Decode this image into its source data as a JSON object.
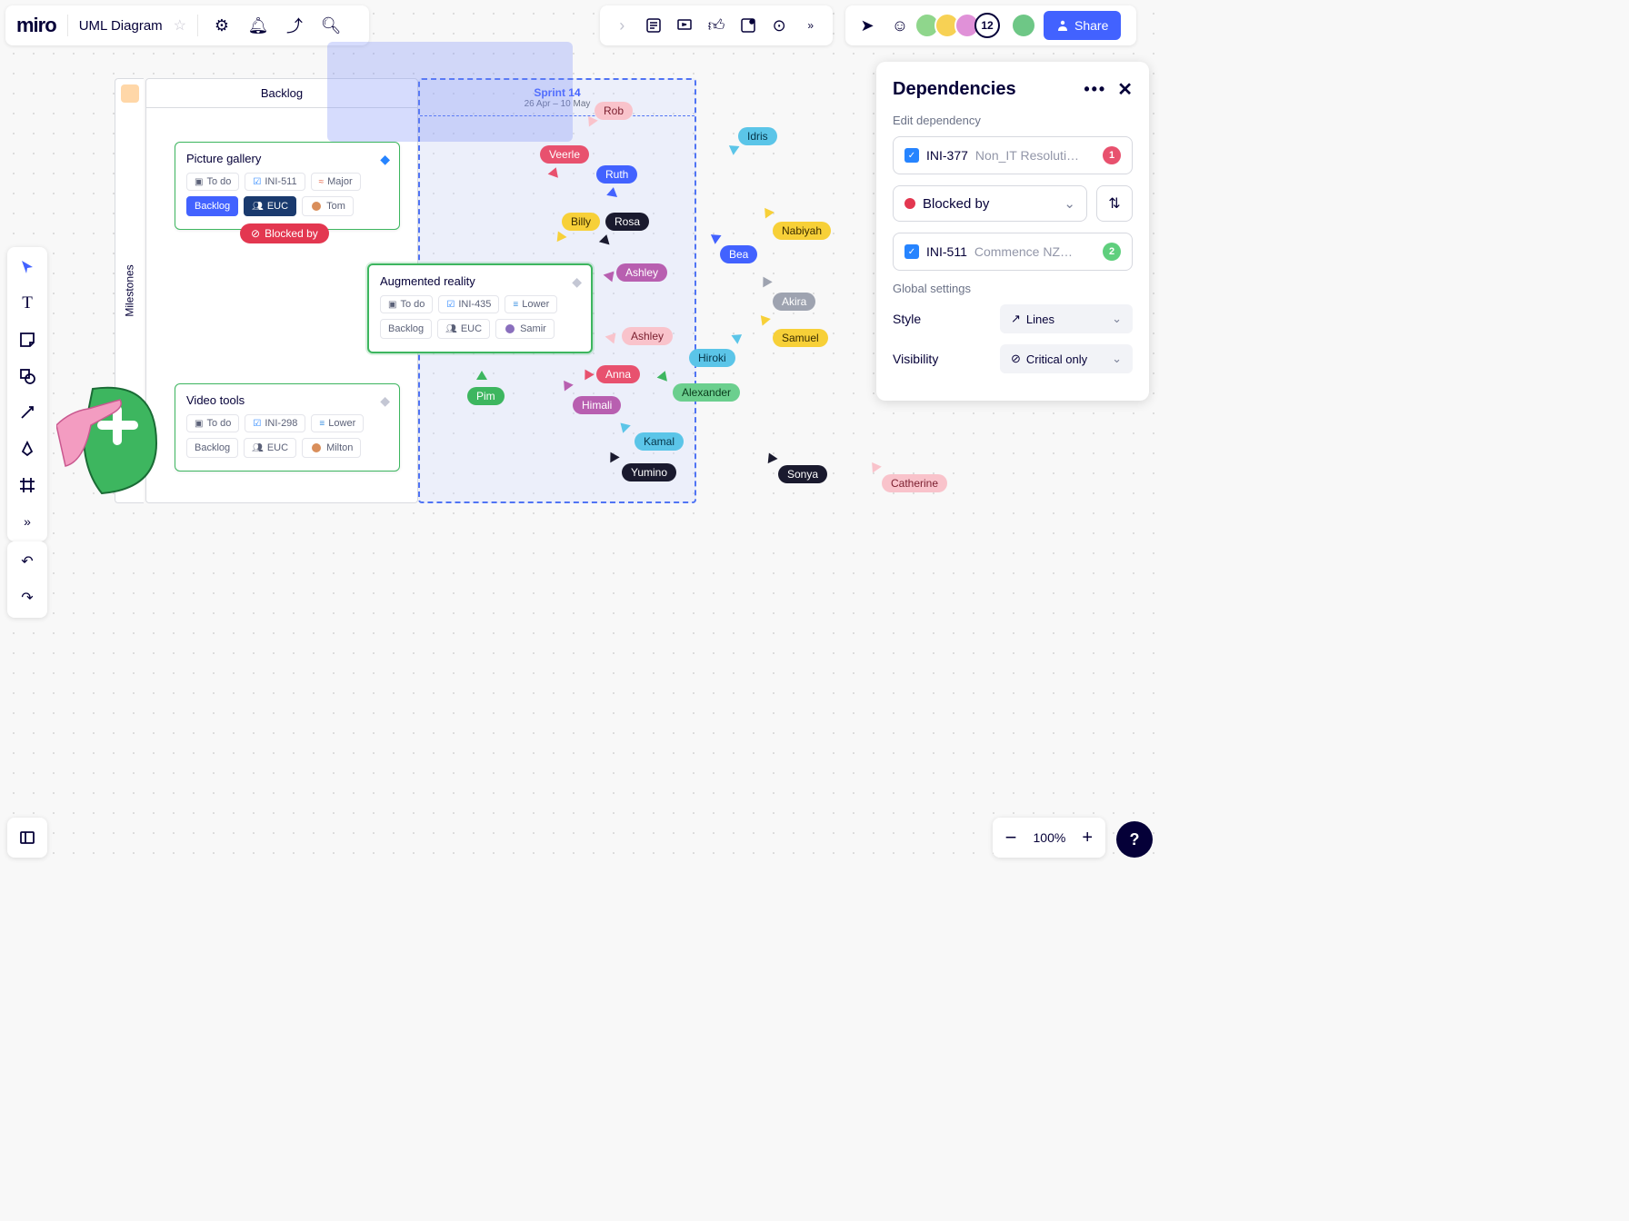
{
  "app": {
    "logo": "miro",
    "board_title": "UML Diagram"
  },
  "share": {
    "label": "Share"
  },
  "collab": {
    "overflow_count": "12"
  },
  "zoom": {
    "level": "100%"
  },
  "columns": {
    "backlog": "Backlog",
    "sprint_title": "Sprint 14",
    "sprint_dates": "26 Apr – 10 May",
    "milestones": "Milestones"
  },
  "cards": {
    "picture": {
      "title": "Picture gallery",
      "todo": "To do",
      "id": "INI-511",
      "priority": "Major",
      "status": "Backlog",
      "team": "EUC",
      "assignee": "Tom"
    },
    "augmented": {
      "title": "Augmented reality",
      "todo": "To do",
      "id": "INI-435",
      "priority": "Lower",
      "status": "Backlog",
      "team": "EUC",
      "assignee": "Samir"
    },
    "video": {
      "title": "Video tools",
      "todo": "To do",
      "id": "INI-298",
      "priority": "Lower",
      "status": "Backlog",
      "team": "EUC",
      "assignee": "Milton"
    }
  },
  "blocked_badge": "Blocked by",
  "cursors": {
    "rob": "Rob",
    "veerle": "Veerle",
    "ruth": "Ruth",
    "billy": "Billy",
    "rosa": "Rosa",
    "ashley1": "Ashley",
    "ashley2": "Ashley",
    "pim": "Pim",
    "anna": "Anna",
    "alexander": "Alexander",
    "himali": "Himali",
    "kamal": "Kamal",
    "yumino": "Yumino",
    "idris": "Idris",
    "bea": "Bea",
    "nabiyah": "Nabiyah",
    "akira": "Akira",
    "samuel": "Samuel",
    "hiroki": "Hiroki",
    "sonya": "Sonya",
    "catherine": "Catherine"
  },
  "dependencies": {
    "title": "Dependencies",
    "edit_label": "Edit dependency",
    "item1_id": "INI-377",
    "item1_name": "Non_IT Resoluti…",
    "item1_badge": "1",
    "relation": "Blocked by",
    "item2_id": "INI-511",
    "item2_name": "Commence NZ…",
    "item2_badge": "2",
    "global_label": "Global settings",
    "style_label": "Style",
    "style_value": "Lines",
    "visibility_label": "Visibility",
    "visibility_value": "Critical only"
  }
}
